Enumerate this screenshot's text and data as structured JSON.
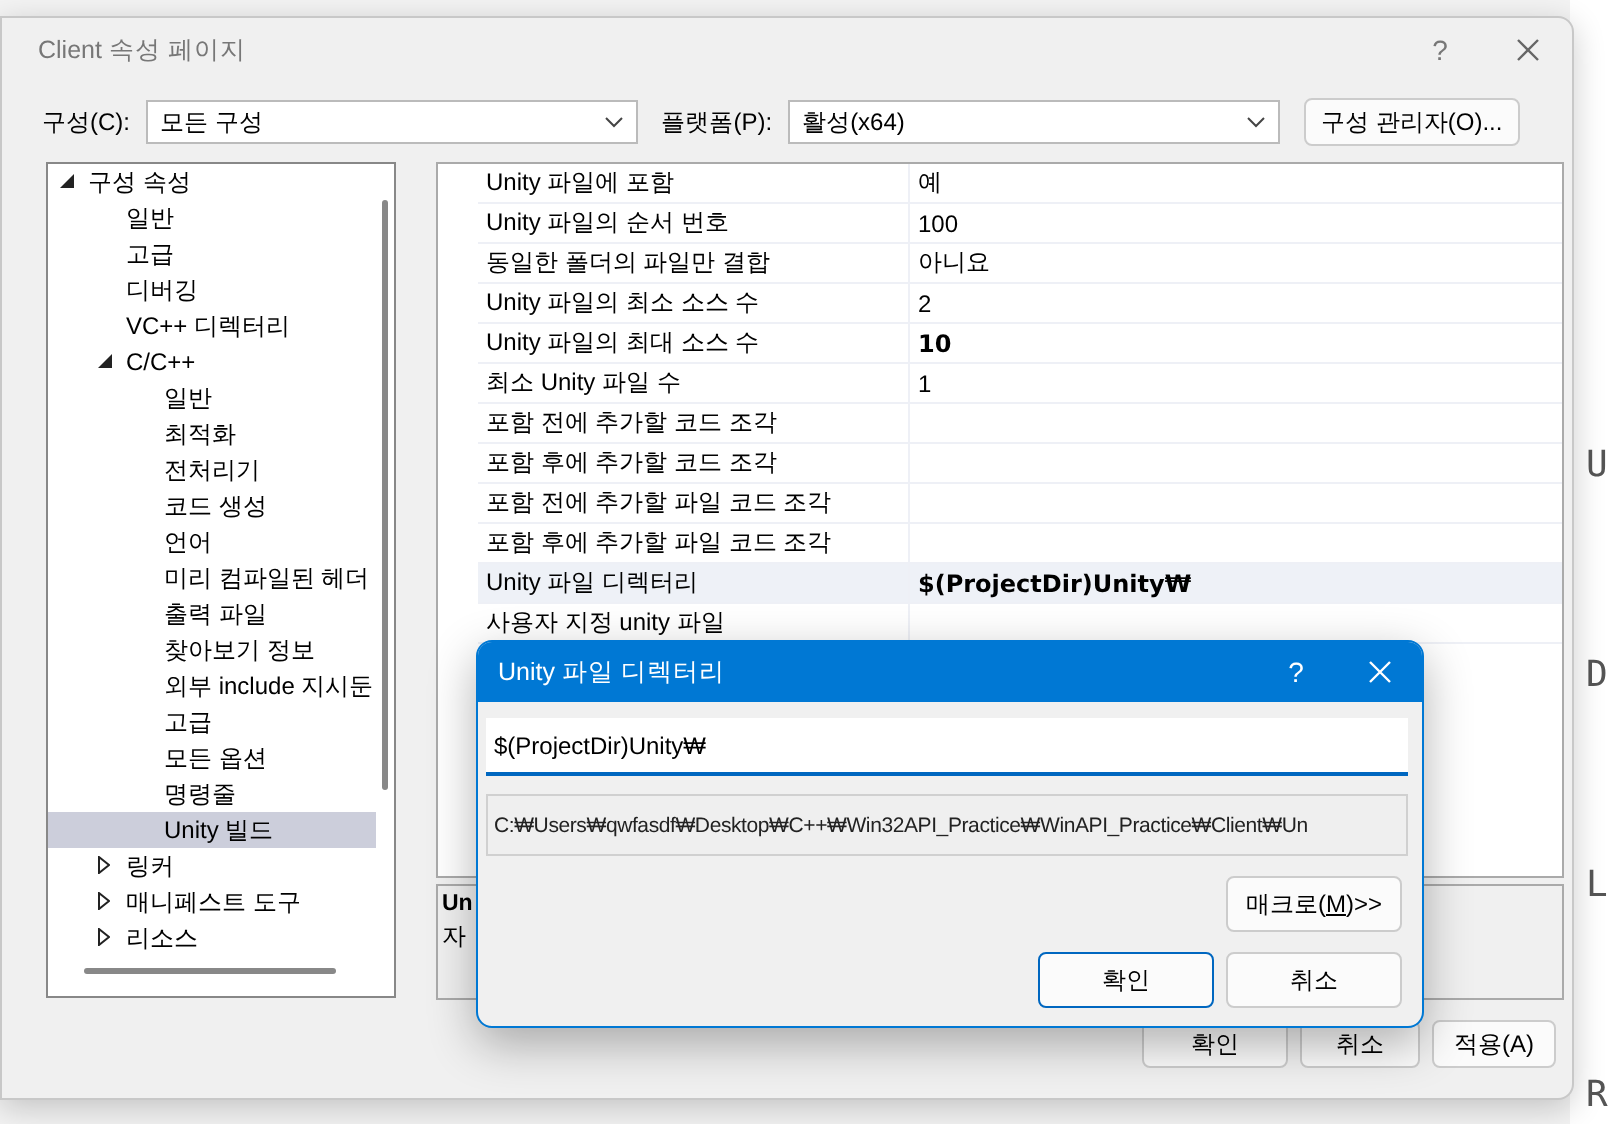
{
  "background": {
    "side_letters": [
      "U",
      "D",
      "L",
      "R"
    ]
  },
  "window": {
    "title": "Client 속성 페이지",
    "help": "?"
  },
  "config_bar": {
    "config_label": "구성(C):",
    "config_value": "모든 구성",
    "platform_label": "플랫폼(P):",
    "platform_value": "활성(x64)",
    "manager_button": "구성 관리자(O)..."
  },
  "tree": [
    {
      "label": "구성 속성",
      "expanded": true,
      "selected": false,
      "children": [
        {
          "label": "일반",
          "selected": false
        },
        {
          "label": "고급",
          "selected": false
        },
        {
          "label": "디버깅",
          "selected": false
        },
        {
          "label": "VC++ 디렉터리",
          "selected": false
        },
        {
          "label": "C/C++",
          "expanded": true,
          "selected": false,
          "children": [
            {
              "label": "일반",
              "selected": false
            },
            {
              "label": "최적화",
              "selected": false
            },
            {
              "label": "전처리기",
              "selected": false
            },
            {
              "label": "코드 생성",
              "selected": false
            },
            {
              "label": "언어",
              "selected": false
            },
            {
              "label": "미리 컴파일된 헤더",
              "selected": false
            },
            {
              "label": "출력 파일",
              "selected": false
            },
            {
              "label": "찾아보기 정보",
              "selected": false
            },
            {
              "label": "외부 include 지시둔",
              "selected": false
            },
            {
              "label": "고급",
              "selected": false
            },
            {
              "label": "모든 옵션",
              "selected": false
            },
            {
              "label": "명령줄",
              "selected": false
            },
            {
              "label": "Unity 빌드",
              "selected": true
            }
          ]
        },
        {
          "label": "링커",
          "expanded": false,
          "selected": false
        },
        {
          "label": "매니페스트 도구",
          "expanded": false,
          "selected": false
        },
        {
          "label": "리소스",
          "expanded": false,
          "selected": false
        }
      ]
    }
  ],
  "properties": [
    {
      "name": "Unity 파일에 포함",
      "value": "예",
      "bold": false,
      "selected": false
    },
    {
      "name": "Unity 파일의 순서 번호",
      "value": "100",
      "bold": false,
      "selected": false
    },
    {
      "name": "동일한 폴더의 파일만 결합",
      "value": "아니요",
      "bold": false,
      "selected": false
    },
    {
      "name": "Unity 파일의 최소 소스 수",
      "value": "2",
      "bold": false,
      "selected": false
    },
    {
      "name": "Unity 파일의 최대 소스 수",
      "value": "10",
      "bold": true,
      "selected": false
    },
    {
      "name": "최소 Unity 파일 수",
      "value": "1",
      "bold": false,
      "selected": false
    },
    {
      "name": "포함 전에 추가할 코드 조각",
      "selected": false
    },
    {
      "name": "포함 후에 추가할 코드 조각",
      "selected": false
    },
    {
      "name": "포함 전에 추가할 파일 코드 조각",
      "selected": false
    },
    {
      "name": "포함 후에 추가할 파일 코드 조각",
      "selected": false
    },
    {
      "name": "Unity 파일 디렉터리",
      "value": "$(ProjectDir)Unity₩",
      "bold": true,
      "selected": true
    },
    {
      "name": "사용자 지정 unity 파일",
      "selected": false
    }
  ],
  "description": {
    "title": "Un",
    "text": "자"
  },
  "buttons": [
    "확인",
    "취소",
    "적용(A)"
  ],
  "modal": {
    "title": "Unity 파일 디렉터리",
    "help": "?",
    "input_value": "$(ProjectDir)Unity₩",
    "evaluated_path": "C:₩Users₩qwfasdf₩Desktop₩C++₩Win32API_Practice₩WinAPI_Practice₩Client₩Un",
    "macro_button": {
      "before": "매크로(",
      "mnemonic": "M",
      "after": ")>>"
    },
    "ok_button": "확인",
    "cancel_button": "취소"
  }
}
